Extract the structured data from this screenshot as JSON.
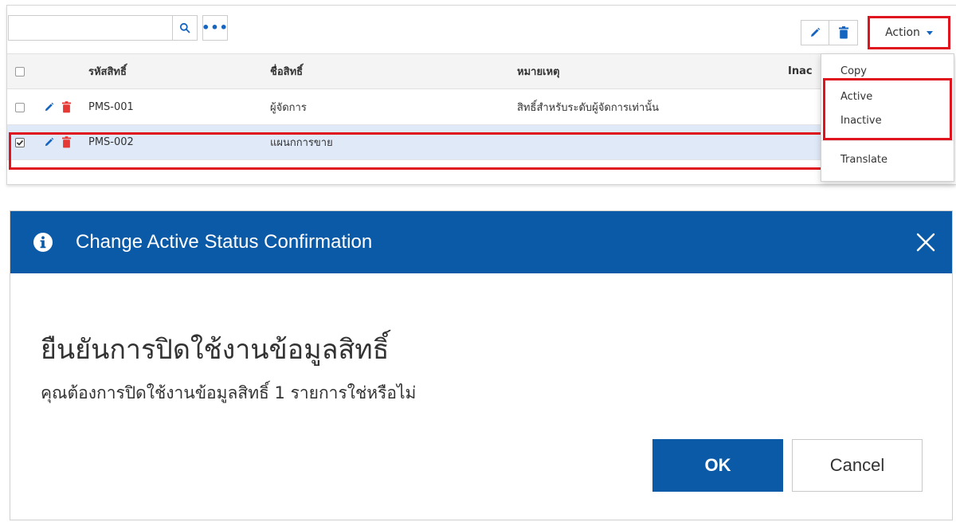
{
  "toolbar": {
    "search_value": "",
    "search_icon": "search-icon",
    "more_label": "•••",
    "action_label": "Action"
  },
  "grid": {
    "columns": {
      "code": "รหัสสิทธิ์",
      "name": "ชื่อสิทธิ์",
      "note": "หมายเหตุ",
      "inactive": "Inac"
    },
    "rows": [
      {
        "code": "PMS-001",
        "name": "ผู้จัดการ",
        "note": "สิทธิ์สำหรับระดับผู้จัดการเท่านั้น",
        "checked": false
      },
      {
        "code": "PMS-002",
        "name": "แผนกการขาย",
        "note": "",
        "checked": true
      }
    ]
  },
  "menu": {
    "items": [
      "Copy",
      "Active",
      "Inactive",
      "Translate"
    ]
  },
  "dialog": {
    "title": "Change Active Status Confirmation",
    "heading": "ยืนยันการปิดใช้งานข้อมูลสิทธิ์",
    "message": "คุณต้องการปิดใช้งานข้อมูลสิทธิ์ 1 รายการใช่หรือไม่",
    "ok_label": "OK",
    "cancel_label": "Cancel"
  },
  "colors": {
    "primary": "#0b5aa8",
    "highlight": "#e0141e",
    "selected_row": "#dfe9f7",
    "delete_icon": "#e53935"
  }
}
